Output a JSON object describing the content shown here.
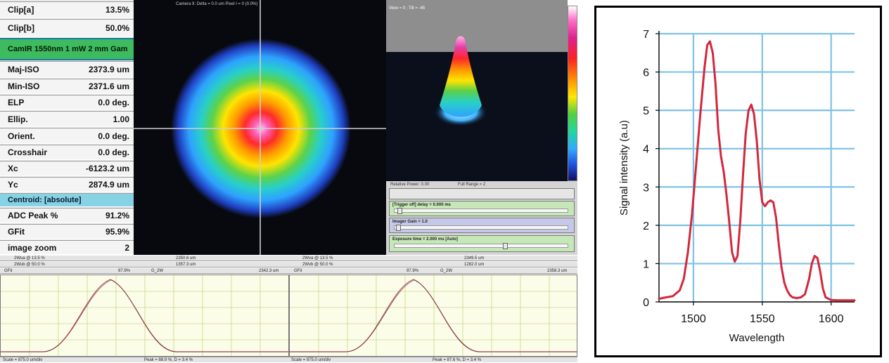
{
  "params": {
    "rows": [
      {
        "label": "Clip[a]",
        "value": "13.5%"
      },
      {
        "label": "Clip[b]",
        "value": "50.0%"
      },
      {
        "label": "CamIR 1550nm 1 mW 2 mm Gam",
        "value": ""
      },
      {
        "label": "Maj-ISO",
        "value": "2373.9 um"
      },
      {
        "label": "Min-ISO",
        "value": "2371.6 um"
      },
      {
        "label": "ELP",
        "value": "0.0 deg."
      },
      {
        "label": "Ellip.",
        "value": "1.00"
      },
      {
        "label": "Orient.",
        "value": "0.0 deg."
      },
      {
        "label": "Crosshair",
        "value": "0.0 deg."
      },
      {
        "label": "Xc",
        "value": "-6123.2 um"
      },
      {
        "label": "Yc",
        "value": "2874.9 um"
      },
      {
        "label": "Centroid: [absolute]",
        "value": ""
      },
      {
        "label": "ADC Peak %",
        "value": "91.2%"
      },
      {
        "label": "GFit",
        "value": "95.9%"
      },
      {
        "label": "image zoom",
        "value": "2"
      }
    ]
  },
  "beam_view": {
    "header": "Camera 9: Delta = 0.0 um Pixel I = 0 (0.0%)"
  },
  "view3d": {
    "header": "View = 0 ; Tilt = -45"
  },
  "controls": {
    "relative_power": "Relative Power: 0.00",
    "full_range": "Full Range = 2",
    "trigger_label": "[Trigger off] delay = 0.000 ms",
    "trigger_fraction": 0.03,
    "gain_label": "Imager Gain = 1.0",
    "gain_fraction": 0.02,
    "exposure_label": "Exposure time = 2.000 ms [Auto]",
    "exposure_fraction": 0.64
  },
  "profiles": [
    {
      "wa_label": "2Wua @ 13.5 %",
      "wa_value": "2350.6 um",
      "wb_label": "2Wub @ 50.0 %",
      "wb_value": "1357.3 um",
      "gfit_label": "GFit",
      "gfit_value": "97.9%",
      "g2w_label": "G_2W",
      "g2w_value": "2342.3 um",
      "scale": "Scale = 875.0 um/div",
      "peak": "Peak = 88.9 %, D = 3.4 %"
    },
    {
      "wa_label": "2Wva @ 13.5 %",
      "wa_value": "2349.5 um",
      "wb_label": "2Wvb @ 50.0 %",
      "wb_value": "1282.0 um",
      "gfit_label": "GFit",
      "gfit_value": "97.9%",
      "g2w_label": "G_2W",
      "g2w_value": "2358.3 um",
      "scale": "Scale = 875.0 um/div",
      "peak": "Peak = 87.6 %, D = 3.4 %"
    }
  ],
  "chart_data": {
    "type": "line",
    "xlabel": "Wavelength",
    "ylabel": "Signal intensity (a.u)",
    "xlim": [
      1475,
      1617
    ],
    "ylim": [
      0,
      7
    ],
    "x_ticks": [
      1500,
      1550,
      1600
    ],
    "y_ticks": [
      0,
      1,
      2,
      3,
      4,
      5,
      6,
      7
    ],
    "grid": true,
    "line_color": "#d3273b",
    "grid_color": "#7fc2e5",
    "x": [
      1475,
      1480,
      1485,
      1490,
      1493,
      1496,
      1499,
      1502,
      1505,
      1508,
      1510,
      1512,
      1514,
      1516,
      1518,
      1520,
      1522,
      1524,
      1526,
      1528,
      1530,
      1532,
      1534,
      1536,
      1538,
      1540,
      1542,
      1544,
      1546,
      1548,
      1550,
      1552,
      1554,
      1556,
      1558,
      1560,
      1562,
      1564,
      1566,
      1568,
      1570,
      1572,
      1575,
      1578,
      1581,
      1584,
      1586,
      1588,
      1590,
      1592,
      1594,
      1596,
      1600,
      1605,
      1610,
      1617
    ],
    "y": [
      0.08,
      0.12,
      0.15,
      0.3,
      0.6,
      1.3,
      2.3,
      3.6,
      4.9,
      6.1,
      6.7,
      6.8,
      6.5,
      5.7,
      4.5,
      3.8,
      3.4,
      2.8,
      2.1,
      1.3,
      1.05,
      1.2,
      2.1,
      3.3,
      4.4,
      5.0,
      5.15,
      4.9,
      4.2,
      3.2,
      2.6,
      2.5,
      2.6,
      2.65,
      2.6,
      2.2,
      1.5,
      0.9,
      0.5,
      0.3,
      0.18,
      0.12,
      0.1,
      0.12,
      0.2,
      0.6,
      1.0,
      1.2,
      1.15,
      0.8,
      0.35,
      0.12,
      0.05,
      0.04,
      0.04,
      0.04
    ]
  }
}
